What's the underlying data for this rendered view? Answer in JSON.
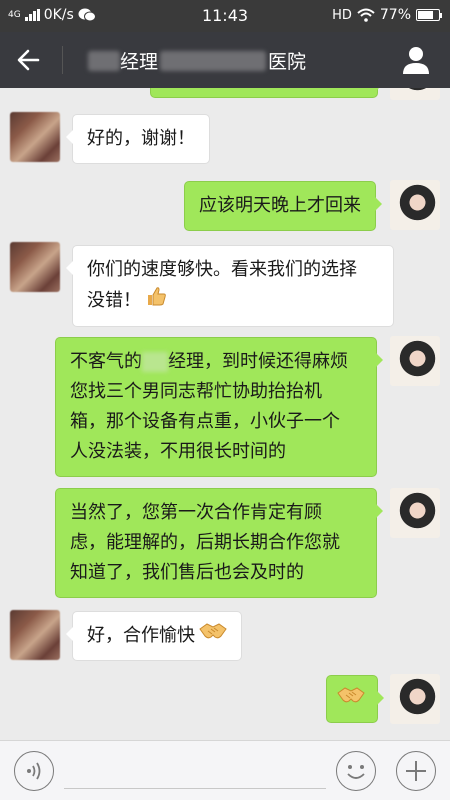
{
  "status_bar": {
    "network_type": "4G",
    "speed": "0K/s",
    "time": "11:43",
    "hd": "HD",
    "battery": "77%",
    "battery_level": 0.77,
    "chat_app_icon": "wechat-icon"
  },
  "nav": {
    "title_part1": "经理",
    "title_part2": "医院",
    "back_icon": "back-arrow-icon",
    "contact_icon": "person-icon"
  },
  "messages": [
    {
      "side": "right",
      "text": ""
    },
    {
      "side": "left",
      "text": "好的，谢谢！"
    },
    {
      "side": "right",
      "text": "应该明天晚上才回来"
    },
    {
      "side": "left",
      "line1": "你们的速度够快。看来我们的选择",
      "line2": "没错！",
      "emoji": "thumbs-up-icon"
    },
    {
      "side": "right",
      "line1a": "不客气的",
      "line1b": "经理，到时候还得麻烦",
      "line2": "您找三个男同志帮忙协助抬抬机",
      "line3": "箱，那个设备有点重，小伙子一个",
      "line4": "人没法装，不用很长时间的"
    },
    {
      "side": "right",
      "line1": "当然了，您第一次合作肯定有顾",
      "line2": "虑，能理解的，后期长期合作您就",
      "line3": "知道了，我们售后也会及时的"
    },
    {
      "side": "left",
      "text": "好，合作愉快",
      "emoji": "handshake-icon"
    },
    {
      "side": "right",
      "text": "",
      "emoji": "handshake-icon"
    }
  ],
  "input": {
    "placeholder": "",
    "voice_icon": "voice-icon",
    "emoji_icon": "smiley-icon",
    "plus_icon": "plus-icon"
  },
  "colors": {
    "sent_bubble": "#a0e75a",
    "received_bubble": "#ffffff",
    "nav_bg": "#393a3f",
    "chat_bg": "#ebebeb"
  }
}
